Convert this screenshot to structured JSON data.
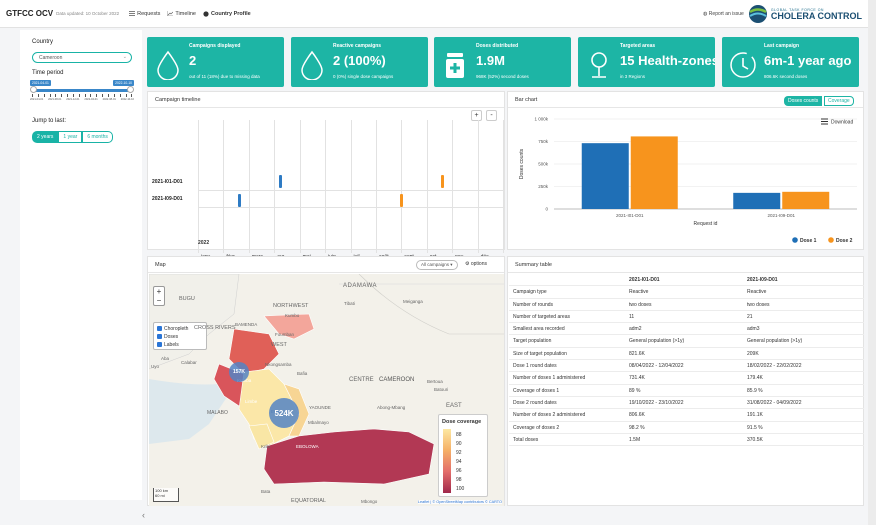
{
  "nav": {
    "brand": "GTFCC OCV",
    "updated": "Data updated: 10 October 2022",
    "links": [
      "Requests",
      "Timeline",
      "Country Profile"
    ],
    "report": "Report an issue",
    "logo_small": "GLOBAL TASK FORCE ON",
    "logo_big": "CHOLERA CONTROL"
  },
  "sidebar": {
    "country_label": "Country",
    "country_value": "Cameroon",
    "period_label": "Time period",
    "period_start": "2021-04-01",
    "period_end": "2022-10-10",
    "period_ticks": [
      "2021-04-01",
      "2021-08-01",
      "2021-12-01",
      "2022-04-01",
      "2022-08-01",
      "2022-10-10"
    ],
    "jump_label": "Jump to last:",
    "jump_buttons": [
      "2 years",
      "1 year",
      "6 months"
    ]
  },
  "cards": [
    {
      "title": "Campaigns displayed",
      "value": "2",
      "sub": "out of 11 (18%) due to missing data",
      "icon": "drop-icon"
    },
    {
      "title": "Reactive campaigns",
      "value": "2 (100%)",
      "sub": "0 (0%) single dose campaigns",
      "icon": "drop-icon"
    },
    {
      "title": "Doses distributed",
      "value": "1.9M",
      "sub": "968K (52%) second doses",
      "icon": "medicine-jar-icon"
    },
    {
      "title": "Targeted areas",
      "value": "15 Health-zones",
      "sub": "in 3 Regions",
      "icon": "location-pin-icon"
    },
    {
      "title": "Last campaign",
      "value": "6m-1 year ago",
      "sub": "806.6K second doses",
      "icon": "clock-icon"
    }
  ],
  "timeline": {
    "title": "Campaign timeline",
    "rows": [
      "2021-I01-D01",
      "2021-I09-D01"
    ],
    "months": [
      "janv.",
      "févr.",
      "mars",
      "avr.",
      "mai",
      "juin",
      "juil.",
      "août",
      "sept.",
      "oct.",
      "nov.",
      "déc."
    ],
    "year": "2022",
    "zoom_in": "+",
    "zoom_out": "-",
    "colors": {
      "dose1": "#2e7bc4",
      "dose2": "#f7941d"
    }
  },
  "barchart": {
    "title": "Bar chart",
    "tabs": [
      "Doses counts",
      "Coverage"
    ],
    "download": "Download",
    "menu_icon": "hamburger-icon"
  },
  "chart_data": {
    "type": "bar",
    "categories": [
      "2021-I01-D01",
      "2021-I09-D01"
    ],
    "series": [
      {
        "name": "Dose 1",
        "values": [
          731400,
          179400
        ],
        "color": "#1f6fb6"
      },
      {
        "name": "Dose 2",
        "values": [
          806600,
          191100
        ],
        "color": "#f7941d"
      }
    ],
    "xlabel": "Request id",
    "ylabel": "Doses counts",
    "yticks": [
      "0",
      "250k",
      "500k",
      "750k",
      "1 000k"
    ],
    "ylim": [
      0,
      1000000
    ],
    "legend": "bottom-right",
    "grid": true
  },
  "map": {
    "title": "Map",
    "filter": "All campaigns",
    "options": "options",
    "layers": [
      "Choropleth",
      "Doses",
      "Labels"
    ],
    "places": [
      "ADAMAWA",
      "NORTHWEST",
      "Tibati",
      "Meiganga",
      "Kumbo",
      "BAMENDA",
      "Foumban",
      "WEST",
      "CENTRE",
      "CAMEROON",
      "Bertoua",
      "Batouri",
      "YAOUNDE",
      "Edea",
      "Abong-Mbang",
      "MALABO",
      "Mbalmayo",
      "EBOLOWA",
      "Kribi",
      "Bata",
      "EQUATORIAL",
      "Kumba",
      "Nkongsamba",
      "Bafia",
      "Limbe",
      "Calabar",
      "Aba",
      "BUGU",
      "Uyo",
      "CROSS RIVERS",
      "EAST",
      "Mbongo"
    ],
    "bubbles": [
      "157K",
      "524K"
    ],
    "legend_title": "Dose coverage",
    "legend_values": [
      "88",
      "90",
      "92",
      "94",
      "96",
      "98",
      "100"
    ],
    "scale": [
      "100 km",
      "60 mi"
    ],
    "attribution": "Leaflet | © OpenStreetMap contributors © CARTO"
  },
  "summary": {
    "title": "Summary table",
    "columns": [
      "",
      "2021-I01-D01",
      "2021-I09-D01"
    ],
    "rows": [
      [
        "Campaign type",
        "Reactive",
        "Reactive"
      ],
      [
        "Number of rounds",
        "two doses",
        "two doses"
      ],
      [
        "Number of targeted areas",
        "11",
        "21"
      ],
      [
        "Smallest area recorded",
        "adm2",
        "adm3"
      ],
      [
        "Target population",
        "General population (>1y)",
        "General population (>1y)"
      ],
      [
        "Size of target population",
        "821.6K",
        "209K"
      ],
      [
        "Dose 1 round dates",
        "08/04/2022 - 12/04/2022",
        "18/02/2022 - 22/02/2022"
      ],
      [
        "Number of doses 1 administered",
        "731.4K",
        "179.4K"
      ],
      [
        "Coverage of doses 1",
        "89 %",
        "85.9 %"
      ],
      [
        "Dose 2 round dates",
        "19/10/2022 - 23/10/2022",
        "31/08/2022 - 04/09/2022"
      ],
      [
        "Number of doses 2 administered",
        "806.6K",
        "191.1K"
      ],
      [
        "Coverage of doses 2",
        "98.2 %",
        "91.5 %"
      ],
      [
        "Total doses",
        "1.5M",
        "370.5K"
      ]
    ]
  }
}
